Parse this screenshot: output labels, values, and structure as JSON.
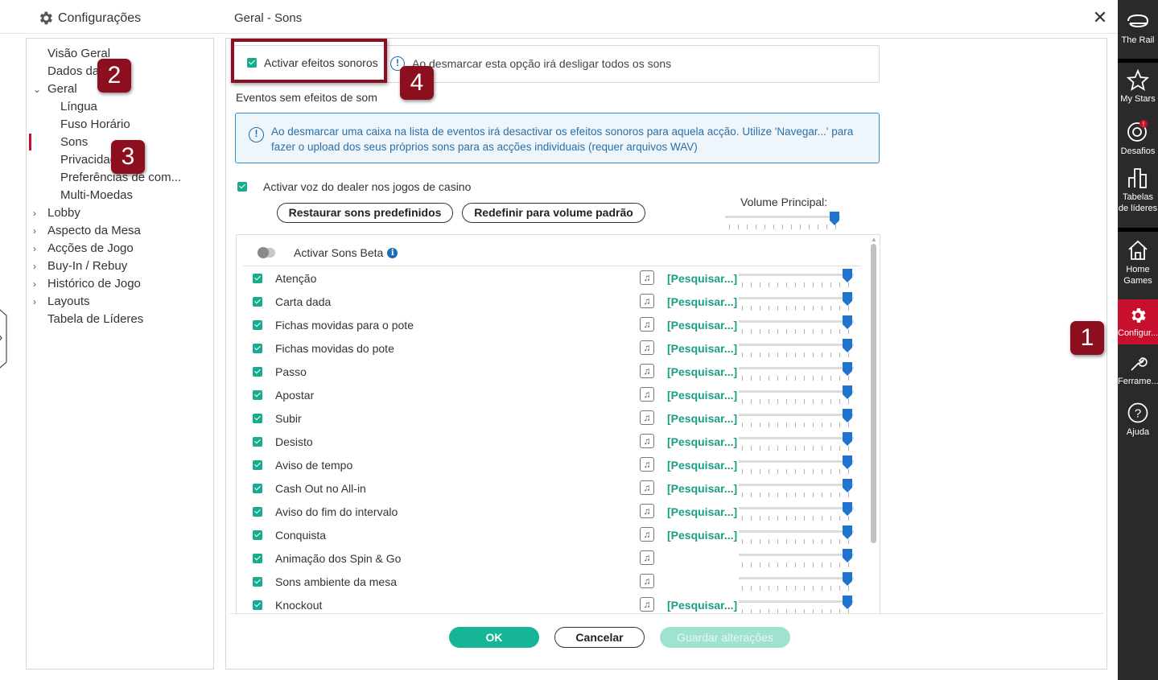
{
  "header": {
    "app_title": "Configurações",
    "page_path": "Geral - Sons",
    "close_label": "✕"
  },
  "nav": {
    "items": [
      {
        "label": "Visão Geral",
        "level": 0,
        "arrow": ""
      },
      {
        "label": "Dados da",
        "level": 0,
        "arrow": ""
      },
      {
        "label": "Geral",
        "level": 0,
        "arrow": "⌄"
      },
      {
        "label": "Língua",
        "level": 1,
        "arrow": ""
      },
      {
        "label": "Fuso Horário",
        "level": 1,
        "arrow": ""
      },
      {
        "label": "Sons",
        "level": 1,
        "arrow": "",
        "active": true
      },
      {
        "label": "Privacidade",
        "level": 1,
        "arrow": ""
      },
      {
        "label": "Preferências de com...",
        "level": 1,
        "arrow": ""
      },
      {
        "label": "Multi-Moedas",
        "level": 1,
        "arrow": ""
      },
      {
        "label": "Lobby",
        "level": 0,
        "arrow": "›"
      },
      {
        "label": "Aspecto da Mesa",
        "level": 0,
        "arrow": "›"
      },
      {
        "label": "Acções de Jogo",
        "level": 0,
        "arrow": "›"
      },
      {
        "label": "Buy-In / Rebuy",
        "level": 0,
        "arrow": "›"
      },
      {
        "label": "Histórico de Jogo",
        "level": 0,
        "arrow": "›"
      },
      {
        "label": "Layouts",
        "level": 0,
        "arrow": "›"
      },
      {
        "label": "Tabela de Líderes",
        "level": 0,
        "arrow": ""
      }
    ]
  },
  "main": {
    "master_checkbox_label": "Activar efeitos sonoros",
    "master_info_text": "Ao desmarcar esta opção irá desligar todos os sons",
    "events_heading": "Eventos sem efeitos de som",
    "info_box_text": "Ao desmarcar uma caixa na lista de eventos irá desactivar os efeitos sonoros para aquela acção. Utilize 'Navegar...' para fazer o upload dos seus próprios sons para as acções individuais (requer arquivos WAV)",
    "dealer_voice_label": "Activar voz do dealer nos jogos de casino",
    "restore_button": "Restaurar sons predefinidos",
    "reset_volume_button": "Redefinir para volume padrão",
    "master_volume_label": "Volume Principal:",
    "master_volume_level": 1.0,
    "beta_label": "Activar Sons Beta",
    "info_glyph": "i",
    "note_glyph": "♫",
    "sounds": [
      {
        "label": "Atenção",
        "browse": "[Pesquisar...]",
        "volume": 1.0
      },
      {
        "label": "Carta dada",
        "browse": "[Pesquisar...]",
        "volume": 1.0
      },
      {
        "label": "Fichas movidas para o pote",
        "browse": "[Pesquisar...]",
        "volume": 1.0
      },
      {
        "label": "Fichas movidas do pote",
        "browse": "[Pesquisar...]",
        "volume": 1.0
      },
      {
        "label": "Passo",
        "browse": "[Pesquisar...]",
        "volume": 1.0
      },
      {
        "label": "Apostar",
        "browse": "[Pesquisar...]",
        "volume": 1.0
      },
      {
        "label": "Subir",
        "browse": "[Pesquisar...]",
        "volume": 1.0
      },
      {
        "label": "Desisto",
        "browse": "[Pesquisar...]",
        "volume": 1.0
      },
      {
        "label": "Aviso de tempo",
        "browse": "[Pesquisar...]",
        "volume": 1.0
      },
      {
        "label": "Cash Out no All-in",
        "browse": "[Pesquisar...]",
        "volume": 1.0
      },
      {
        "label": "Aviso do fim do intervalo",
        "browse": "[Pesquisar...]",
        "volume": 1.0
      },
      {
        "label": "Conquista",
        "browse": "[Pesquisar...]",
        "volume": 1.0
      },
      {
        "label": "Animação dos Spin & Go",
        "browse": "",
        "volume": 1.0
      },
      {
        "label": "Sons ambiente da mesa",
        "browse": "",
        "volume": 1.0
      },
      {
        "label": "Knockout",
        "browse": "[Pesquisar...]",
        "volume": 1.0
      }
    ]
  },
  "footer": {
    "ok": "OK",
    "cancel": "Cancelar",
    "save": "Guardar alterações"
  },
  "rail": {
    "items": [
      {
        "label": "The Rail",
        "icon": "rail-icon"
      },
      {
        "label": "My Stars",
        "icon": "star-icon"
      },
      {
        "label": "Desafios",
        "icon": "target-icon"
      },
      {
        "label": "Tabelas de líderes",
        "icon": "leaderboard-icon"
      },
      {
        "label": "Home Games",
        "icon": "home-icon"
      },
      {
        "label": "Configur...",
        "icon": "gear-icon"
      },
      {
        "label": "Ferrame...",
        "icon": "wrench-icon"
      },
      {
        "label": "Ajuda",
        "icon": "help-icon"
      }
    ]
  },
  "callouts": [
    "1",
    "2",
    "3",
    "4"
  ],
  "colors": {
    "accent_green": "#1aaa8e",
    "brand_red": "#c8102e",
    "callout_red": "#8b0f1e",
    "slider_blue": "#1f74d0"
  }
}
